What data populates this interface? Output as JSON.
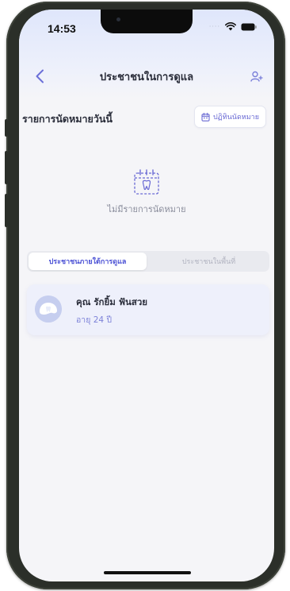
{
  "status_bar": {
    "time": "14:53",
    "signal_icon": "signal-dots-icon",
    "wifi_icon": "wifi-icon",
    "battery_icon": "battery-icon"
  },
  "nav": {
    "title": "ประชาชนในการดูแล",
    "back_icon": "chevron-left-icon",
    "add_icon": "add-person-icon"
  },
  "appointments": {
    "title": "รายการนัดหมายวันนี้",
    "calendar_button_label": "ปฏิทินนัดหมาย",
    "calendar_icon": "calendar-icon",
    "empty_icon": "empty-calendar-tooth-icon",
    "empty_text": "ไม่มีรายการนัดหมาย"
  },
  "tabs": [
    {
      "label": "ประชาชนภายใต้การดูแล",
      "active": true
    },
    {
      "label": "ประชาชนในพื้นที่",
      "active": false
    }
  ],
  "people": [
    {
      "name": "คุณ รักยิ้ม ฟันสวย",
      "age": "อายุ 24 ปี",
      "avatar_icon": "avatar-icon"
    }
  ],
  "colors": {
    "accent": "#4f55d6",
    "header_gradient_top": "#dfe6fb",
    "card_bg": "#eef0fb"
  }
}
